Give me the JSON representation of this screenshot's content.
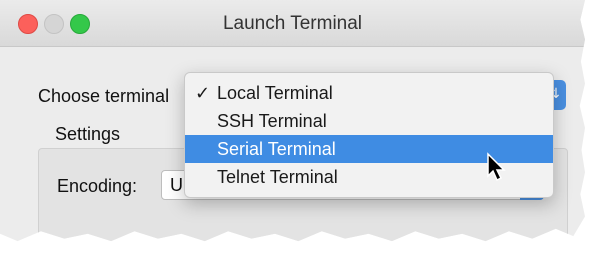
{
  "window": {
    "title": "Launch Terminal"
  },
  "form": {
    "choose_terminal_label": "Choose terminal",
    "settings_title": "Settings",
    "encoding_label": "Encoding:",
    "encoding_value": "U"
  },
  "dropdown": {
    "items": [
      {
        "label": "Local Terminal",
        "checked": true
      },
      {
        "label": "SSH Terminal"
      },
      {
        "label": "Serial Terminal",
        "highlighted": true
      },
      {
        "label": "Telnet Terminal"
      }
    ],
    "check_glyph": "✓"
  },
  "colors": {
    "accent": "#3f8ce3",
    "close": "#fc605b",
    "minimize": "#d5d5d5",
    "maximize": "#34c84a"
  },
  "icons": {
    "close": "close-icon",
    "minimize": "minimize-icon",
    "maximize": "maximize-icon",
    "cursor": "mouse-pointer-icon",
    "check": "checkmark-icon"
  }
}
